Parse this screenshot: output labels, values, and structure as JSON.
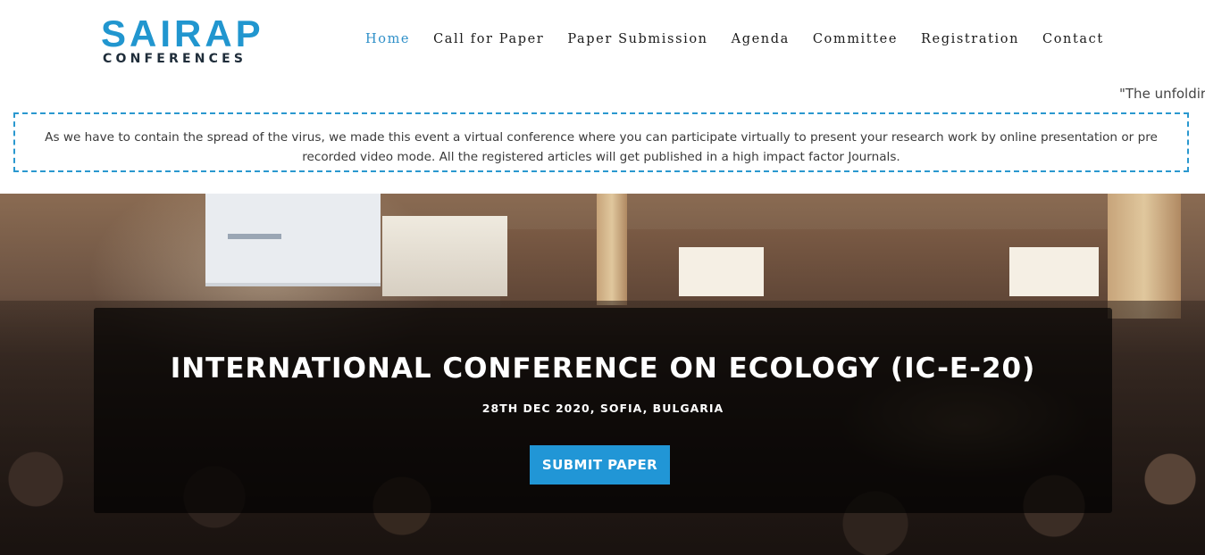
{
  "brand": {
    "name": "SAIRAP",
    "tagline": "CONFERENCES",
    "color": "#2196cf"
  },
  "nav": {
    "items": [
      {
        "label": "Home",
        "active": true
      },
      {
        "label": "Call for Paper",
        "active": false
      },
      {
        "label": "Paper Submission",
        "active": false
      },
      {
        "label": "Agenda",
        "active": false
      },
      {
        "label": "Committee",
        "active": false
      },
      {
        "label": "Registration",
        "active": false
      },
      {
        "label": "Contact",
        "active": false
      }
    ]
  },
  "ticker": {
    "text": "\"The unfoldir"
  },
  "notice": {
    "text": "As we have to contain the spread of the virus, we made this event a virtual conference where you can participate virtually to present your research work by online presentation or pre recorded video mode. All the registered articles will get published in a high impact factor Journals.",
    "border_color": "#2a98cf"
  },
  "hero": {
    "title": "INTERNATIONAL CONFERENCE ON ECOLOGY (IC-E-20)",
    "subtitle": "28TH DEC 2020, SOFIA, BULGARIA",
    "button_label": "SUBMIT PAPER",
    "button_color": "#2196d6"
  }
}
